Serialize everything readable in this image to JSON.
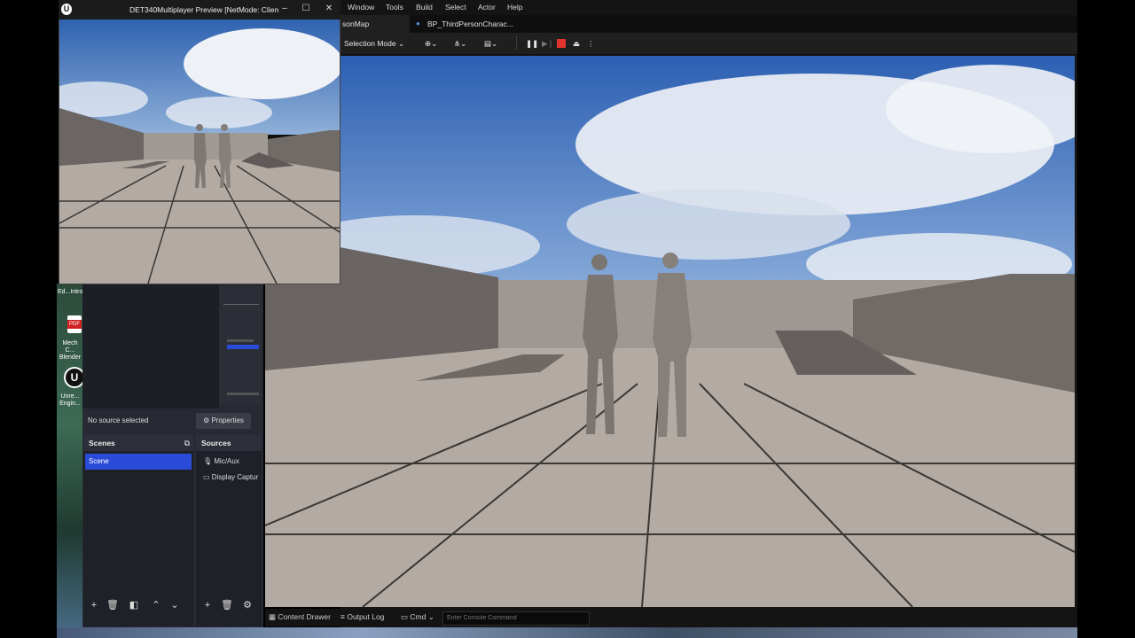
{
  "ue": {
    "menu": [
      "Window",
      "Tools",
      "Build",
      "Select",
      "Actor",
      "Help"
    ],
    "tabs": {
      "map": "sonMap",
      "blueprint": "BP_ThirdPersonCharac..."
    },
    "toolbar": {
      "mode": "Selection Mode"
    },
    "bottom": {
      "content_drawer": "Content Drawer",
      "output_log": "Output Log",
      "cmd": "Cmd",
      "console_placeholder": "Enter Console Command"
    }
  },
  "preview_window": {
    "title": "DET340Multiplayer Preview [NetMode: Clien"
  },
  "desktop": {
    "icons": [
      "Ed...Intro",
      "PDF",
      "Mech C... Blender",
      "Unre... Engin..."
    ]
  },
  "obs": {
    "no_source": "No source selected",
    "properties": "Properties",
    "scenes_title": "Scenes",
    "scene_item": "Scene",
    "sources_title": "Sources",
    "sources": [
      "Mic/Aux",
      "Display Captur"
    ]
  },
  "colors": {
    "accent_blue": "#2a4bd7",
    "stop_red": "#e0342d",
    "sky": "#3a6fc0",
    "floor": "#b3aba3"
  }
}
